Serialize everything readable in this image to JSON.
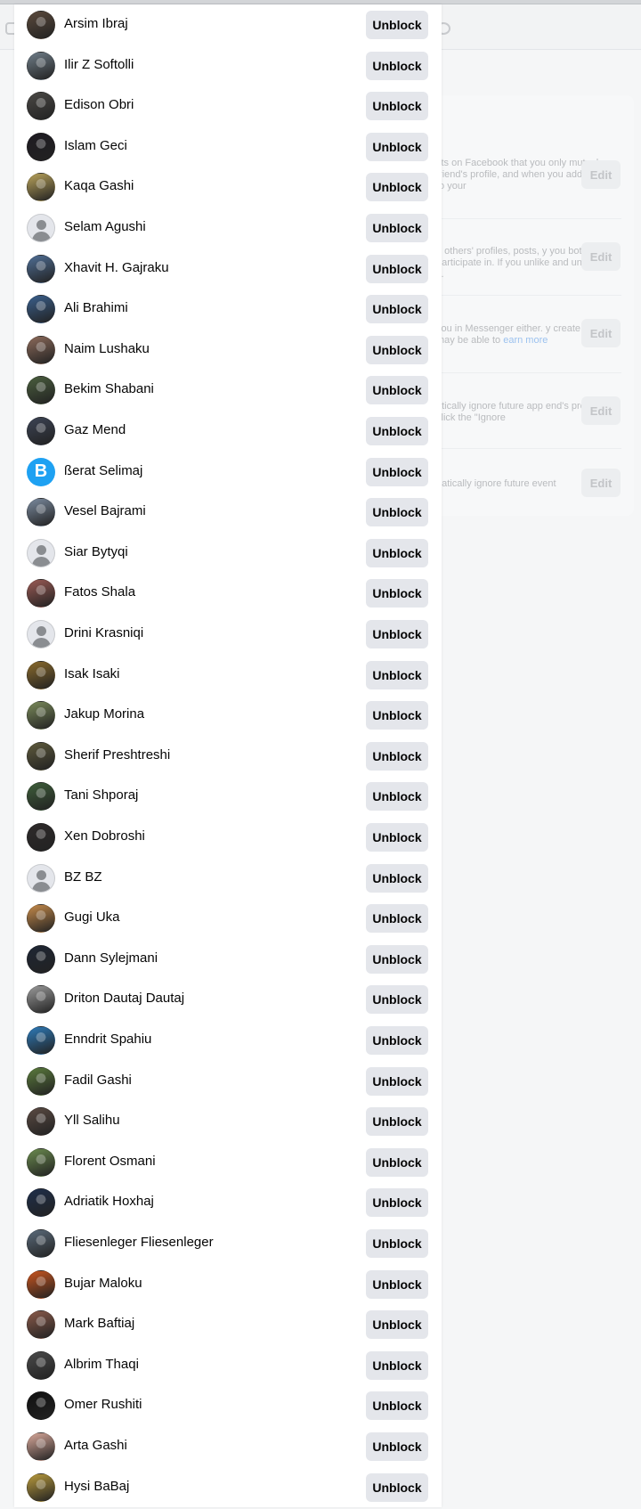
{
  "blocked_list": {
    "unblock_label": "Unblock",
    "items": [
      {
        "name": "Arsim Ibraj",
        "avatar": "photo",
        "color": "#5b4a3c"
      },
      {
        "name": "Ilir Z Softolli",
        "avatar": "photo",
        "color": "#6f7d88"
      },
      {
        "name": "Edison Obri",
        "avatar": "photo",
        "color": "#4a4845"
      },
      {
        "name": "Islam Geci",
        "avatar": "photo",
        "color": "#1e1b22"
      },
      {
        "name": "Kaqa Gashi",
        "avatar": "photo",
        "color": "#b8a25a"
      },
      {
        "name": "Selam Agushi",
        "avatar": "default",
        "color": "#e4e6eb"
      },
      {
        "name": "Xhavit H. Gajraku",
        "avatar": "photo",
        "color": "#4f6e95"
      },
      {
        "name": "Ali Brahimi",
        "avatar": "photo",
        "color": "#3a5f8c"
      },
      {
        "name": "Naim Lushaku",
        "avatar": "photo",
        "color": "#8c6a5a"
      },
      {
        "name": "Bekim Shabani",
        "avatar": "photo",
        "color": "#4a5e3e"
      },
      {
        "name": "Gaz Mend",
        "avatar": "photo",
        "color": "#3c4354"
      },
      {
        "name": "ßerat Selimaj",
        "avatar": "brand",
        "color": "#1ea1f2"
      },
      {
        "name": "Vesel Bajrami",
        "avatar": "photo",
        "color": "#7a8a9e"
      },
      {
        "name": "Siar Bytyqi",
        "avatar": "default",
        "color": "#e4e6eb"
      },
      {
        "name": "Fatos Shala",
        "avatar": "photo",
        "color": "#9a5a54"
      },
      {
        "name": "Drini Krasniqi",
        "avatar": "default",
        "color": "#e4e6eb"
      },
      {
        "name": "Isak Isaki",
        "avatar": "photo",
        "color": "#8a6a2c"
      },
      {
        "name": "Jakup Morina",
        "avatar": "photo",
        "color": "#7a8a5a"
      },
      {
        "name": "Sherif Preshtreshi",
        "avatar": "photo",
        "color": "#5e5a3c"
      },
      {
        "name": "Tani Shporaj",
        "avatar": "photo",
        "color": "#3e5e3a"
      },
      {
        "name": "Xen Dobroshi",
        "avatar": "photo",
        "color": "#2e2a2a"
      },
      {
        "name": "BZ BZ",
        "avatar": "default",
        "color": "#e4e6eb"
      },
      {
        "name": "Gugi Uka",
        "avatar": "photo",
        "color": "#c58a4a"
      },
      {
        "name": "Dann Sylejmani",
        "avatar": "photo",
        "color": "#1e2634"
      },
      {
        "name": "Driton Dautaj Dautaj",
        "avatar": "photo",
        "color": "#9a9a9a"
      },
      {
        "name": "Enndrit Spahiu",
        "avatar": "photo",
        "color": "#2e7ab8"
      },
      {
        "name": "Fadil Gashi",
        "avatar": "photo",
        "color": "#5a7a3c"
      },
      {
        "name": "Yll Salihu",
        "avatar": "photo",
        "color": "#5a4a42"
      },
      {
        "name": "Florent Osmani",
        "avatar": "photo",
        "color": "#6a8a4e"
      },
      {
        "name": "Adriatik Hoxhaj",
        "avatar": "photo",
        "color": "#1e2e4a"
      },
      {
        "name": "Fliesenleger Fliesenleger",
        "avatar": "photo",
        "color": "#5a6a7a"
      },
      {
        "name": "Bujar Maloku",
        "avatar": "photo",
        "color": "#c8541e"
      },
      {
        "name": "Mark Baftiaj",
        "avatar": "photo",
        "color": "#8a5a4a"
      },
      {
        "name": "Albrim Thaqi",
        "avatar": "photo",
        "color": "#4a4a4a"
      },
      {
        "name": "Omer Rushiti",
        "avatar": "photo",
        "color": "#111111"
      },
      {
        "name": "Arta Gashi",
        "avatar": "photo",
        "color": "#d8a89a"
      },
      {
        "name": "Hysi BaBaj",
        "avatar": "photo",
        "color": "#b89a3c"
      }
    ]
  },
  "background": {
    "rows": [
      {
        "text": "sts on Facebook that you only mutual friend's profile, and when you add them to your",
        "edit": "Edit"
      },
      {
        "text": "h others' profiles, posts, y you both participate in. If you unlike and unfollow it.",
        "edit": "Edit"
      },
      {
        "text": "you in Messenger either. y create, they may be able to",
        "link": "earn more",
        "edit": "Edit"
      },
      {
        "text": "atically ignore future app end's profile, click the \"Ignore",
        "edit": "Edit"
      },
      {
        "text": "natically ignore future event",
        "edit": "Edit"
      }
    ]
  }
}
